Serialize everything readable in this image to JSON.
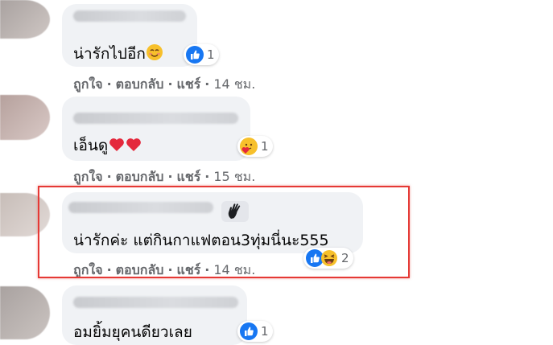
{
  "actions": {
    "like": "ถูกใจ",
    "reply": "ตอบกลับ",
    "share": "แชร์",
    "separator": "·"
  },
  "comments": [
    {
      "text": "น่ารักไปอีก",
      "emoji": "smiling-face-icon",
      "time": "14 ชม.",
      "reactions": {
        "icons": [
          "like-icon"
        ],
        "count": "1"
      }
    },
    {
      "text": "เอ็นดู",
      "emoji": "red-heart-icon",
      "time": "15 ชม.",
      "reactions": {
        "icons": [
          "care-icon"
        ],
        "count": "1"
      }
    },
    {
      "text": "น่ารักค่ะ แต่กินกาแฟตอน3ทุ่มนี่นะ555",
      "badge": "waving-hand-icon",
      "time": "14 ชม.",
      "reactions": {
        "icons": [
          "like-icon",
          "haha-icon"
        ],
        "count": "2"
      },
      "highlighted": true
    },
    {
      "text": "อมยิ้มยุคนดียวเลย",
      "reactions": {
        "icons": [
          "like-icon"
        ],
        "count": "1"
      }
    }
  ],
  "colors": {
    "bubble": "#f0f2f5",
    "action_text": "#65676b",
    "like_blue": "#1877f2",
    "heart_red": "#e4283c",
    "highlight_red": "#e53935"
  }
}
